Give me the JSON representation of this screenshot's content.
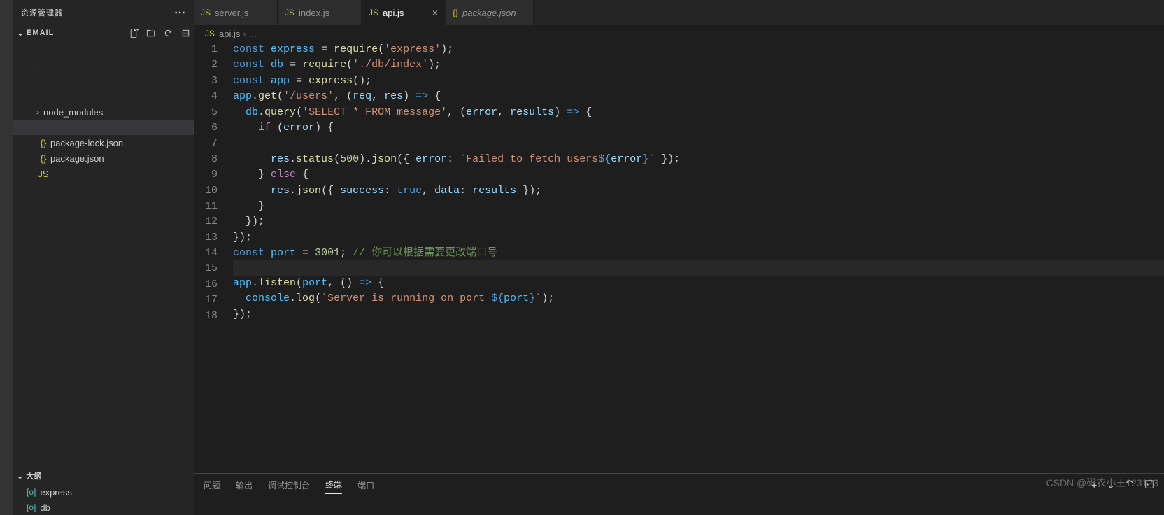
{
  "explorer": {
    "title": "资源管理器",
    "folder": "EMAIL",
    "tree": [
      {
        "label": "",
        "indent": 14,
        "chev": "",
        "icon": "",
        "obscured": true
      },
      {
        "label": "..",
        "indent": 34,
        "chev": "",
        "icon": "",
        "obscured": true
      },
      {
        "label": "",
        "indent": 14,
        "chev": "",
        "icon": "",
        "obscured": true
      },
      {
        "label": "",
        "indent": 34,
        "chev": "",
        "icon": "",
        "obscured": true
      },
      {
        "label": "node_modules",
        "indent": 28,
        "chev": "›",
        "icon": ""
      },
      {
        "label": "",
        "indent": 14,
        "chev": "",
        "icon": "",
        "selected": true,
        "obscured": true
      },
      {
        "label": "package-lock.json",
        "indent": 34,
        "chev": "",
        "icon": "{}",
        "iconClass": "icon-json"
      },
      {
        "label": "package.json",
        "indent": 34,
        "chev": "",
        "icon": "{}",
        "iconClass": "icon-json"
      },
      {
        "label": "",
        "indent": 34,
        "chev": "",
        "icon": "JS",
        "iconClass": "icon-js",
        "obscured": true
      }
    ],
    "outline": {
      "title": "大纲",
      "items": [
        {
          "label": "express"
        },
        {
          "label": "db"
        }
      ]
    }
  },
  "tabs": [
    {
      "label": "server.js",
      "icon": "JS",
      "iconClass": "icon-js",
      "active": false
    },
    {
      "label": "index.js",
      "icon": "JS",
      "iconClass": "icon-js",
      "active": false
    },
    {
      "label": "api.js",
      "icon": "JS",
      "iconClass": "icon-js",
      "active": true
    },
    {
      "label": "package.json",
      "icon": "{}",
      "iconClass": "icon-json",
      "active": false,
      "italic": true
    }
  ],
  "breadcrumb": {
    "icon": "JS",
    "file": "api.js",
    "rest": "..."
  },
  "code": {
    "lines": [
      [
        [
          "kw",
          "const"
        ],
        [
          "punc",
          " "
        ],
        [
          "var",
          "express"
        ],
        [
          "punc",
          " "
        ],
        [
          "punc",
          "="
        ],
        [
          "punc",
          " "
        ],
        [
          "fn",
          "require"
        ],
        [
          "punc",
          "("
        ],
        [
          "str",
          "'express'"
        ],
        [
          "punc",
          ");"
        ]
      ],
      [
        [
          "kw",
          "const"
        ],
        [
          "punc",
          " "
        ],
        [
          "var",
          "db"
        ],
        [
          "punc",
          " "
        ],
        [
          "punc",
          "="
        ],
        [
          "punc",
          " "
        ],
        [
          "fn",
          "require"
        ],
        [
          "punc",
          "("
        ],
        [
          "str",
          "'./db/index'"
        ],
        [
          "punc",
          ");"
        ]
      ],
      [
        [
          "kw",
          "const"
        ],
        [
          "punc",
          " "
        ],
        [
          "var",
          "app"
        ],
        [
          "punc",
          " "
        ],
        [
          "punc",
          "="
        ],
        [
          "punc",
          " "
        ],
        [
          "fn",
          "express"
        ],
        [
          "punc",
          "();"
        ]
      ],
      [
        [
          "var",
          "app"
        ],
        [
          "punc",
          "."
        ],
        [
          "fn",
          "get"
        ],
        [
          "punc",
          "("
        ],
        [
          "str",
          "'/users'"
        ],
        [
          "punc",
          ", ("
        ],
        [
          "param",
          "req"
        ],
        [
          "punc",
          ", "
        ],
        [
          "param",
          "res"
        ],
        [
          "punc",
          ") "
        ],
        [
          "kw",
          "=>"
        ],
        [
          "punc",
          " {"
        ]
      ],
      [
        [
          "punc",
          "  "
        ],
        [
          "var",
          "db"
        ],
        [
          "punc",
          "."
        ],
        [
          "fn",
          "query"
        ],
        [
          "punc",
          "("
        ],
        [
          "str",
          "'SELECT * FROM message'"
        ],
        [
          "punc",
          ", ("
        ],
        [
          "param",
          "error"
        ],
        [
          "punc",
          ", "
        ],
        [
          "param",
          "results"
        ],
        [
          "punc",
          ") "
        ],
        [
          "kw",
          "=>"
        ],
        [
          "punc",
          " {"
        ]
      ],
      [
        [
          "punc",
          "    "
        ],
        [
          "kw2",
          "if"
        ],
        [
          "punc",
          " ("
        ],
        [
          "param",
          "error"
        ],
        [
          "punc",
          ") {"
        ]
      ],
      [
        [
          "punc",
          " "
        ]
      ],
      [
        [
          "punc",
          "      "
        ],
        [
          "param",
          "res"
        ],
        [
          "punc",
          "."
        ],
        [
          "fn",
          "status"
        ],
        [
          "punc",
          "("
        ],
        [
          "num",
          "500"
        ],
        [
          "punc",
          ")."
        ],
        [
          "fn",
          "json"
        ],
        [
          "punc",
          "({ "
        ],
        [
          "prop",
          "error"
        ],
        [
          "punc",
          ": "
        ],
        [
          "str",
          "`Failed to fetch users"
        ],
        [
          "kw",
          "${"
        ],
        [
          "param",
          "error"
        ],
        [
          "kw",
          "}"
        ],
        [
          "str",
          "`"
        ],
        [
          "punc",
          " });"
        ]
      ],
      [
        [
          "punc",
          "    } "
        ],
        [
          "kw2",
          "else"
        ],
        [
          "punc",
          " {"
        ]
      ],
      [
        [
          "punc",
          "      "
        ],
        [
          "param",
          "res"
        ],
        [
          "punc",
          "."
        ],
        [
          "fn",
          "json"
        ],
        [
          "punc",
          "({ "
        ],
        [
          "prop",
          "success"
        ],
        [
          "punc",
          ": "
        ],
        [
          "bool",
          "true"
        ],
        [
          "punc",
          ", "
        ],
        [
          "prop",
          "data"
        ],
        [
          "punc",
          ": "
        ],
        [
          "param",
          "results"
        ],
        [
          "punc",
          " });"
        ]
      ],
      [
        [
          "punc",
          "    }"
        ]
      ],
      [
        [
          "punc",
          "  });"
        ]
      ],
      [
        [
          "punc",
          "});"
        ]
      ],
      [
        [
          "kw",
          "const"
        ],
        [
          "punc",
          " "
        ],
        [
          "var",
          "port"
        ],
        [
          "punc",
          " "
        ],
        [
          "punc",
          "="
        ],
        [
          "punc",
          " "
        ],
        [
          "num",
          "3001"
        ],
        [
          "punc",
          "; "
        ],
        [
          "comm",
          "// 你可以根据需要更改端口号"
        ]
      ],
      [
        [
          "punc",
          ""
        ]
      ],
      [
        [
          "var",
          "app"
        ],
        [
          "punc",
          "."
        ],
        [
          "fn",
          "listen"
        ],
        [
          "punc",
          "("
        ],
        [
          "var",
          "port"
        ],
        [
          "punc",
          ", () "
        ],
        [
          "kw",
          "=>"
        ],
        [
          "punc",
          " {"
        ]
      ],
      [
        [
          "punc",
          "  "
        ],
        [
          "var",
          "console"
        ],
        [
          "punc",
          "."
        ],
        [
          "fn",
          "log"
        ],
        [
          "punc",
          "("
        ],
        [
          "str",
          "`Server is running on port "
        ],
        [
          "kw",
          "${"
        ],
        [
          "var",
          "port"
        ],
        [
          "kw",
          "}"
        ],
        [
          "str",
          "`"
        ],
        [
          "punc",
          ");"
        ]
      ],
      [
        [
          "punc",
          "});"
        ]
      ]
    ],
    "highlight_line": 15
  },
  "panel": {
    "tabs": [
      "问题",
      "输出",
      "调试控制台",
      "终端",
      "端口"
    ],
    "active": 3
  },
  "watermark": "CSDN @码农小王123123"
}
